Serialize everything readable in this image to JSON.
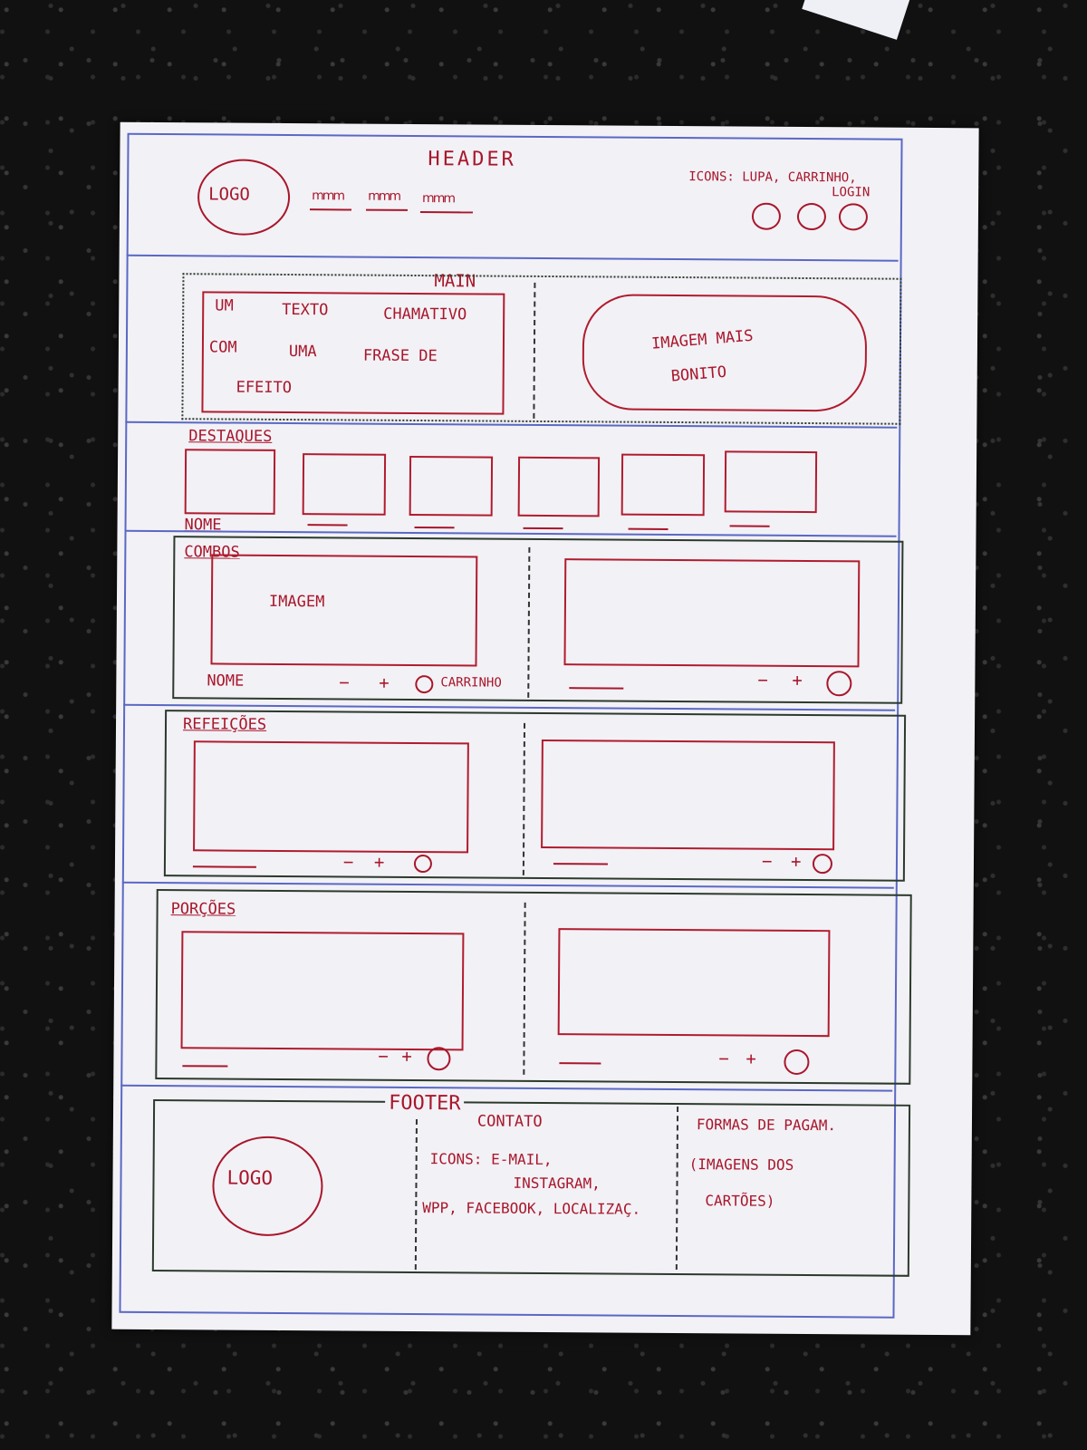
{
  "header": {
    "title": "HEADER",
    "logo": "LOGO",
    "icons_label_1": "ICONS: LUPA, CARRINHO,",
    "icons_label_2": "LOGIN",
    "nav_items": [
      "mmm",
      "mmm",
      "mmm"
    ]
  },
  "main": {
    "title": "MAIN",
    "hero_text": [
      "UM",
      "TEXTO",
      "CHAMATIVO",
      "COM",
      "UMA",
      "FRASE DE",
      "EFEITO"
    ],
    "image_label_1": "IMAGEM MAIS",
    "image_label_2": "BONITO"
  },
  "destaques": {
    "title": "DESTAQUES",
    "name_label": "NOME"
  },
  "combos": {
    "title": "COMBOS",
    "image_label": "IMAGEM",
    "name_label": "NOME",
    "minus": "−",
    "plus": "+",
    "cart_label": "CARRINHO"
  },
  "refeicoes": {
    "title": "REFEIÇÕES",
    "minus": "−",
    "plus": "+"
  },
  "porcoes": {
    "title": "PORÇÕES",
    "minus": "−",
    "plus": "+"
  },
  "footer": {
    "title": "FOOTER",
    "logo": "LOGO",
    "contact_title": "CONTATO",
    "contact_1": "ICONS:  E-MAIL,",
    "contact_2": "INSTAGRAM,",
    "contact_3": "WPP, FACEBOOK, LOCALIZAÇ.",
    "payment_title": "FORMAS DE PAGAM.",
    "payment_1": "(IMAGENS DOS",
    "payment_2": "CARTÕES)"
  },
  "colors": {
    "ink_red": "#a8172b",
    "ink_blue": "#5a68c4",
    "ink_dark": "#2c3a2c",
    "paper": "#f2f1f6"
  }
}
